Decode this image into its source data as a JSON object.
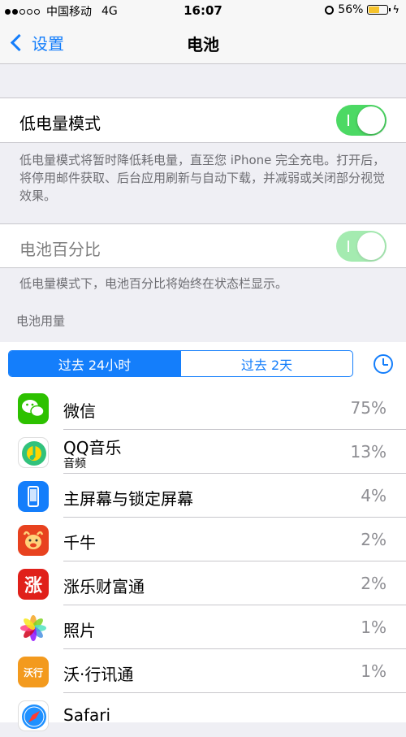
{
  "status_bar": {
    "carrier": "中国移动",
    "network": "4G",
    "time": "16:07",
    "battery_percent": "56%",
    "battery_level": 0.56
  },
  "nav": {
    "back_label": "设置",
    "title": "电池"
  },
  "low_power": {
    "label": "低电量模式",
    "on": true,
    "description": "低电量模式将暂时降低耗电量，直至您 iPhone 完全充电。打开后，将停用邮件获取、后台应用刷新与自动下载，并减弱或关闭部分视觉效果。"
  },
  "battery_percentage": {
    "label": "电池百分比",
    "on": true,
    "disabled": true,
    "description": "低电量模式下，电池百分比将始终在状态栏显示。"
  },
  "usage": {
    "header": "电池用量",
    "segments": [
      "过去 24小时",
      "过去 2天"
    ],
    "selected_segment": 0,
    "apps": [
      {
        "name": "微信",
        "sub": "",
        "percent": "75%",
        "icon": "wechat-icon",
        "color": "#2dc100"
      },
      {
        "name": "QQ音乐",
        "sub": "音频",
        "percent": "13%",
        "icon": "qqmusic-icon",
        "color": "#ffffff"
      },
      {
        "name": "主屏幕与锁定屏幕",
        "sub": "",
        "percent": "4%",
        "icon": "phone-icon",
        "color": "#147efb"
      },
      {
        "name": "千牛",
        "sub": "",
        "percent": "2%",
        "icon": "qianniu-icon",
        "color": "#e8421f"
      },
      {
        "name": "涨乐财富通",
        "sub": "",
        "percent": "2%",
        "icon": "zhangle-icon",
        "color": "#e0201a"
      },
      {
        "name": "照片",
        "sub": "",
        "percent": "1%",
        "icon": "photos-icon",
        "color": "#ffffff"
      },
      {
        "name": "沃·行讯通",
        "sub": "",
        "percent": "1%",
        "icon": "woxingxuntong-icon",
        "color": "#f39a1e"
      },
      {
        "name": "Safari",
        "sub": "",
        "percent": "",
        "icon": "safari-icon",
        "color": "#ffffff"
      }
    ]
  },
  "icon_glyphs": {
    "zhangle": "涨",
    "woxingxuntong": "沃行"
  }
}
